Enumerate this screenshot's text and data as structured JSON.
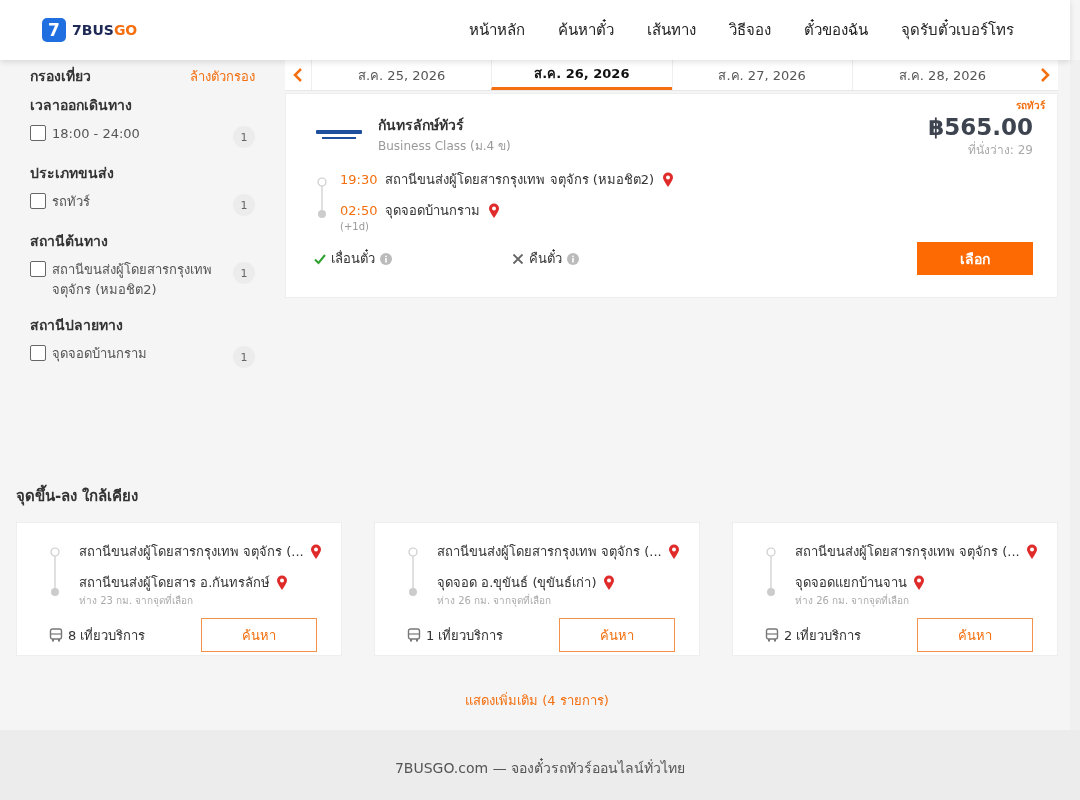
{
  "header": {
    "logo_mark": "7",
    "logo_text_a": "7BUS",
    "logo_text_b": "GO",
    "nav": [
      {
        "label": "หน้าหลัก"
      },
      {
        "label": "ค้นหาตั๋ว"
      },
      {
        "label": "เส้นทาง"
      },
      {
        "label": "วิธีจอง"
      },
      {
        "label": "ตั๋วของฉัน"
      },
      {
        "label": "จุดรับตั๋วเบอร์โทร"
      }
    ]
  },
  "filters": {
    "title": "กรองเที่ยว",
    "clear": "ล้างตัวกรอง",
    "groups": [
      {
        "title": "เวลาออกเดินทาง",
        "options": [
          {
            "label": "18:00 - 24:00",
            "count": "1",
            "checked": false
          }
        ]
      },
      {
        "title": "ประเภทขนส่ง",
        "options": [
          {
            "label": "รถทัวร์",
            "count": "1",
            "checked": false
          }
        ]
      },
      {
        "title": "สถานีต้นทาง",
        "options": [
          {
            "label": "สถานีขนส่งผู้โดยสารกรุงเทพ จตุจักร (หมอชิต2)",
            "count": "1",
            "checked": false
          }
        ]
      },
      {
        "title": "สถานีปลายทาง",
        "options": [
          {
            "label": "จุดจอดบ้านกราม",
            "count": "1",
            "checked": false
          }
        ]
      }
    ]
  },
  "dates": [
    {
      "label": "ส.ค. 25, 2026",
      "selected": false
    },
    {
      "label": "ส.ค. 26, 2026",
      "selected": true
    },
    {
      "label": "ส.ค. 27, 2026",
      "selected": false
    },
    {
      "label": "ส.ค. 28, 2026",
      "selected": false
    }
  ],
  "trip": {
    "type_tag": "รถทัวร์",
    "operator": "กันทรลักษ์ทัวร์",
    "bus_class": "Business Class (ม.4 ข)",
    "price": "฿565.00",
    "seats": "ที่นั่งว่าง: 29",
    "stops": [
      {
        "time": "19:30",
        "name": "สถานีขนส่งผู้โดยสารกรุงเทพ จตุจักร (หมอชิต2)"
      },
      {
        "time": "02:50",
        "name": "จุดจอดบ้านกราม",
        "day_offset": "(+1d)"
      }
    ],
    "policies": [
      {
        "label": "เลื่อนตั๋ว",
        "allowed": true
      },
      {
        "label": "คืนตั๋ว",
        "allowed": false
      }
    ],
    "select_button": "เลือก"
  },
  "nearby": {
    "title": "จุดขึ้น-ลง ใกล้เคียง",
    "cards": [
      {
        "from": "สถานีขนส่งผู้โดยสารกรุงเทพ จตุจักร (...",
        "to": "สถานีขนส่งผู้โดยสาร อ.กันทรลักษ์",
        "distance": "ห่าง 23 กม. จากจุดที่เลือก",
        "trips": "8 เที่ยวบริการ",
        "button": "ค้นหา"
      },
      {
        "from": "สถานีขนส่งผู้โดยสารกรุงเทพ จตุจักร (...",
        "to": "จุดจอด อ.ขุขันธ์ (ขุขันธ์เก่า)",
        "distance": "ห่าง 26 กม. จากจุดที่เลือก",
        "trips": "1 เที่ยวบริการ",
        "button": "ค้นหา"
      },
      {
        "from": "สถานีขนส่งผู้โดยสารกรุงเทพ จตุจักร (...",
        "to": "จุดจอดแยกบ้านจาน",
        "distance": "ห่าง 26 กม. จากจุดที่เลือก",
        "trips": "2 เที่ยวบริการ",
        "button": "ค้นหา"
      }
    ],
    "show_more": "แสดงเพิ่มเติม (4 รายการ)"
  },
  "footer": {
    "text": "7BUSGO.com — จองตั๋วรถทัวร์ออนไลน์ทั่วไทย"
  }
}
